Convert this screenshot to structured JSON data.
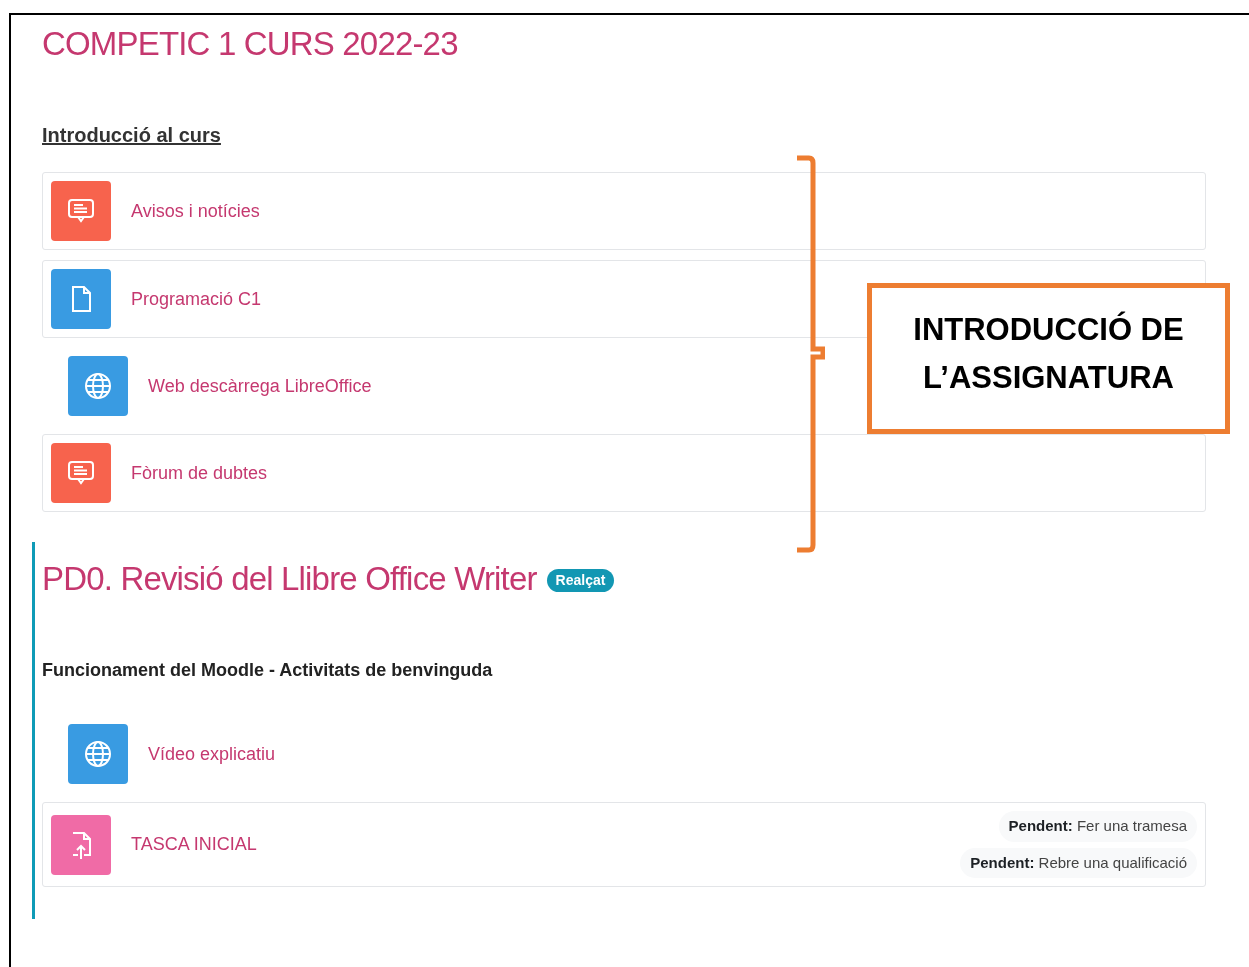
{
  "course_title": "COMPETIC 1 CURS 2022-23",
  "sections": [
    {
      "kind": "plain",
      "title": "Introducció al curs",
      "activities": [
        {
          "kind": "forum",
          "name": "Avisos i notícies",
          "boxed": true
        },
        {
          "kind": "page",
          "name": "Programació C1",
          "boxed": true
        },
        {
          "kind": "url",
          "name": "Web descàrrega LibreOffice",
          "boxed": false
        },
        {
          "kind": "forum",
          "name": "Fòrum de dubtes",
          "boxed": true
        }
      ]
    },
    {
      "kind": "highlighted",
      "title": "PD0. Revisió del Llibre Office Writer",
      "badge": "Realçat",
      "subtitle": "Funcionament del Moodle - Activitats de benvinguda",
      "activities": [
        {
          "kind": "url",
          "name": "Vídeo explicatiu",
          "boxed": false
        },
        {
          "kind": "assign",
          "name": "TASCA INICIAL",
          "boxed": true,
          "completion": [
            {
              "label": "Pendent:",
              "text": "Fer una tramesa"
            },
            {
              "label": "Pendent:",
              "text": "Rebre una qualificació"
            }
          ]
        }
      ]
    }
  ],
  "annotation": {
    "lines": [
      "INTRODUCCIÓ DE",
      "L’ASSIGNATURA"
    ]
  }
}
